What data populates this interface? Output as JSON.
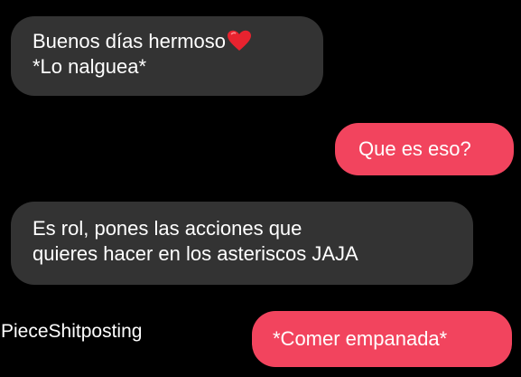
{
  "messages": [
    {
      "direction": "incoming",
      "lines": [
        "Buenos días hermoso",
        "*Lo nalguea*"
      ],
      "emoji": "red-heart-icon"
    },
    {
      "direction": "outgoing",
      "lines": [
        "Que es eso?"
      ]
    },
    {
      "direction": "incoming",
      "lines": [
        "Es rol, pones las acciones que",
        "quieres hacer en los asteriscos JAJA"
      ]
    },
    {
      "direction": "outgoing",
      "lines": [
        "*Comer empanada*"
      ]
    }
  ],
  "watermark": "PieceShitposting",
  "colors": {
    "background": "#000000",
    "incoming_bubble": "#333333",
    "outgoing_bubble": "#f2445e",
    "text": "#ffffff",
    "heart": "#e8232f"
  }
}
